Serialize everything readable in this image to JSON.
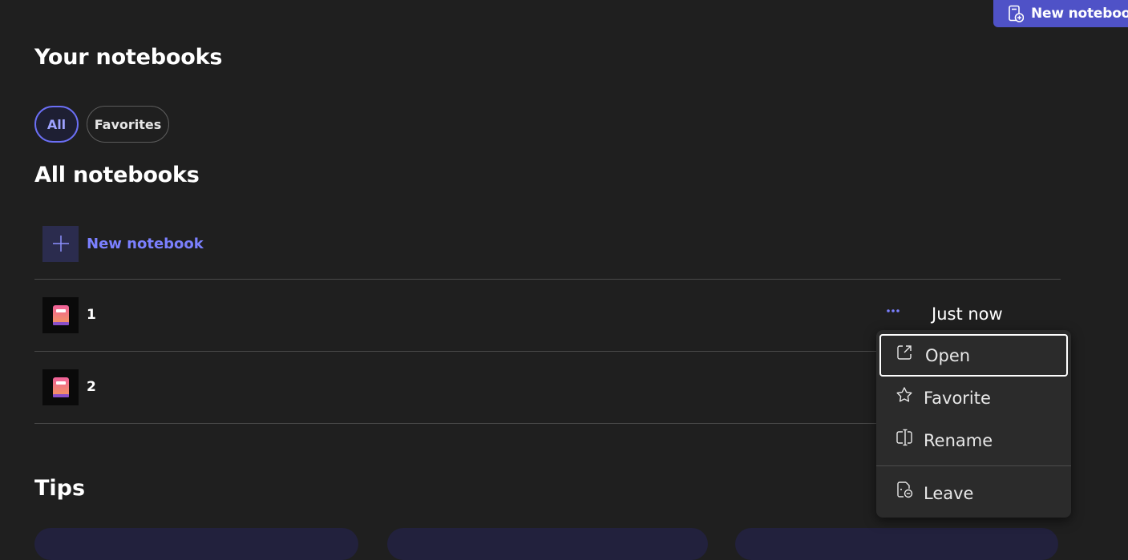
{
  "header": {
    "new_notebook_label": "New notebook"
  },
  "page_title": "Your notebooks",
  "filters": [
    {
      "label": "All",
      "selected": true
    },
    {
      "label": "Favorites",
      "selected": false
    }
  ],
  "section_title": "All notebooks",
  "new_notebook_row": {
    "label": "New notebook"
  },
  "notebooks": [
    {
      "name": "1",
      "modified": "Just now"
    },
    {
      "name": "2",
      "modified": ""
    }
  ],
  "context_menu": {
    "items": [
      {
        "label": "Open",
        "icon": "open-external-icon"
      },
      {
        "label": "Favorite",
        "icon": "star-icon"
      },
      {
        "label": "Rename",
        "icon": "rename-icon"
      },
      {
        "label": "Leave",
        "icon": "leave-notebook-icon"
      }
    ]
  },
  "tips_title": "Tips",
  "colors": {
    "background": "#1f1f1f",
    "accent": "#4f52c7",
    "accent_text": "#7b80ff",
    "menu_background": "#2b2b2b"
  }
}
